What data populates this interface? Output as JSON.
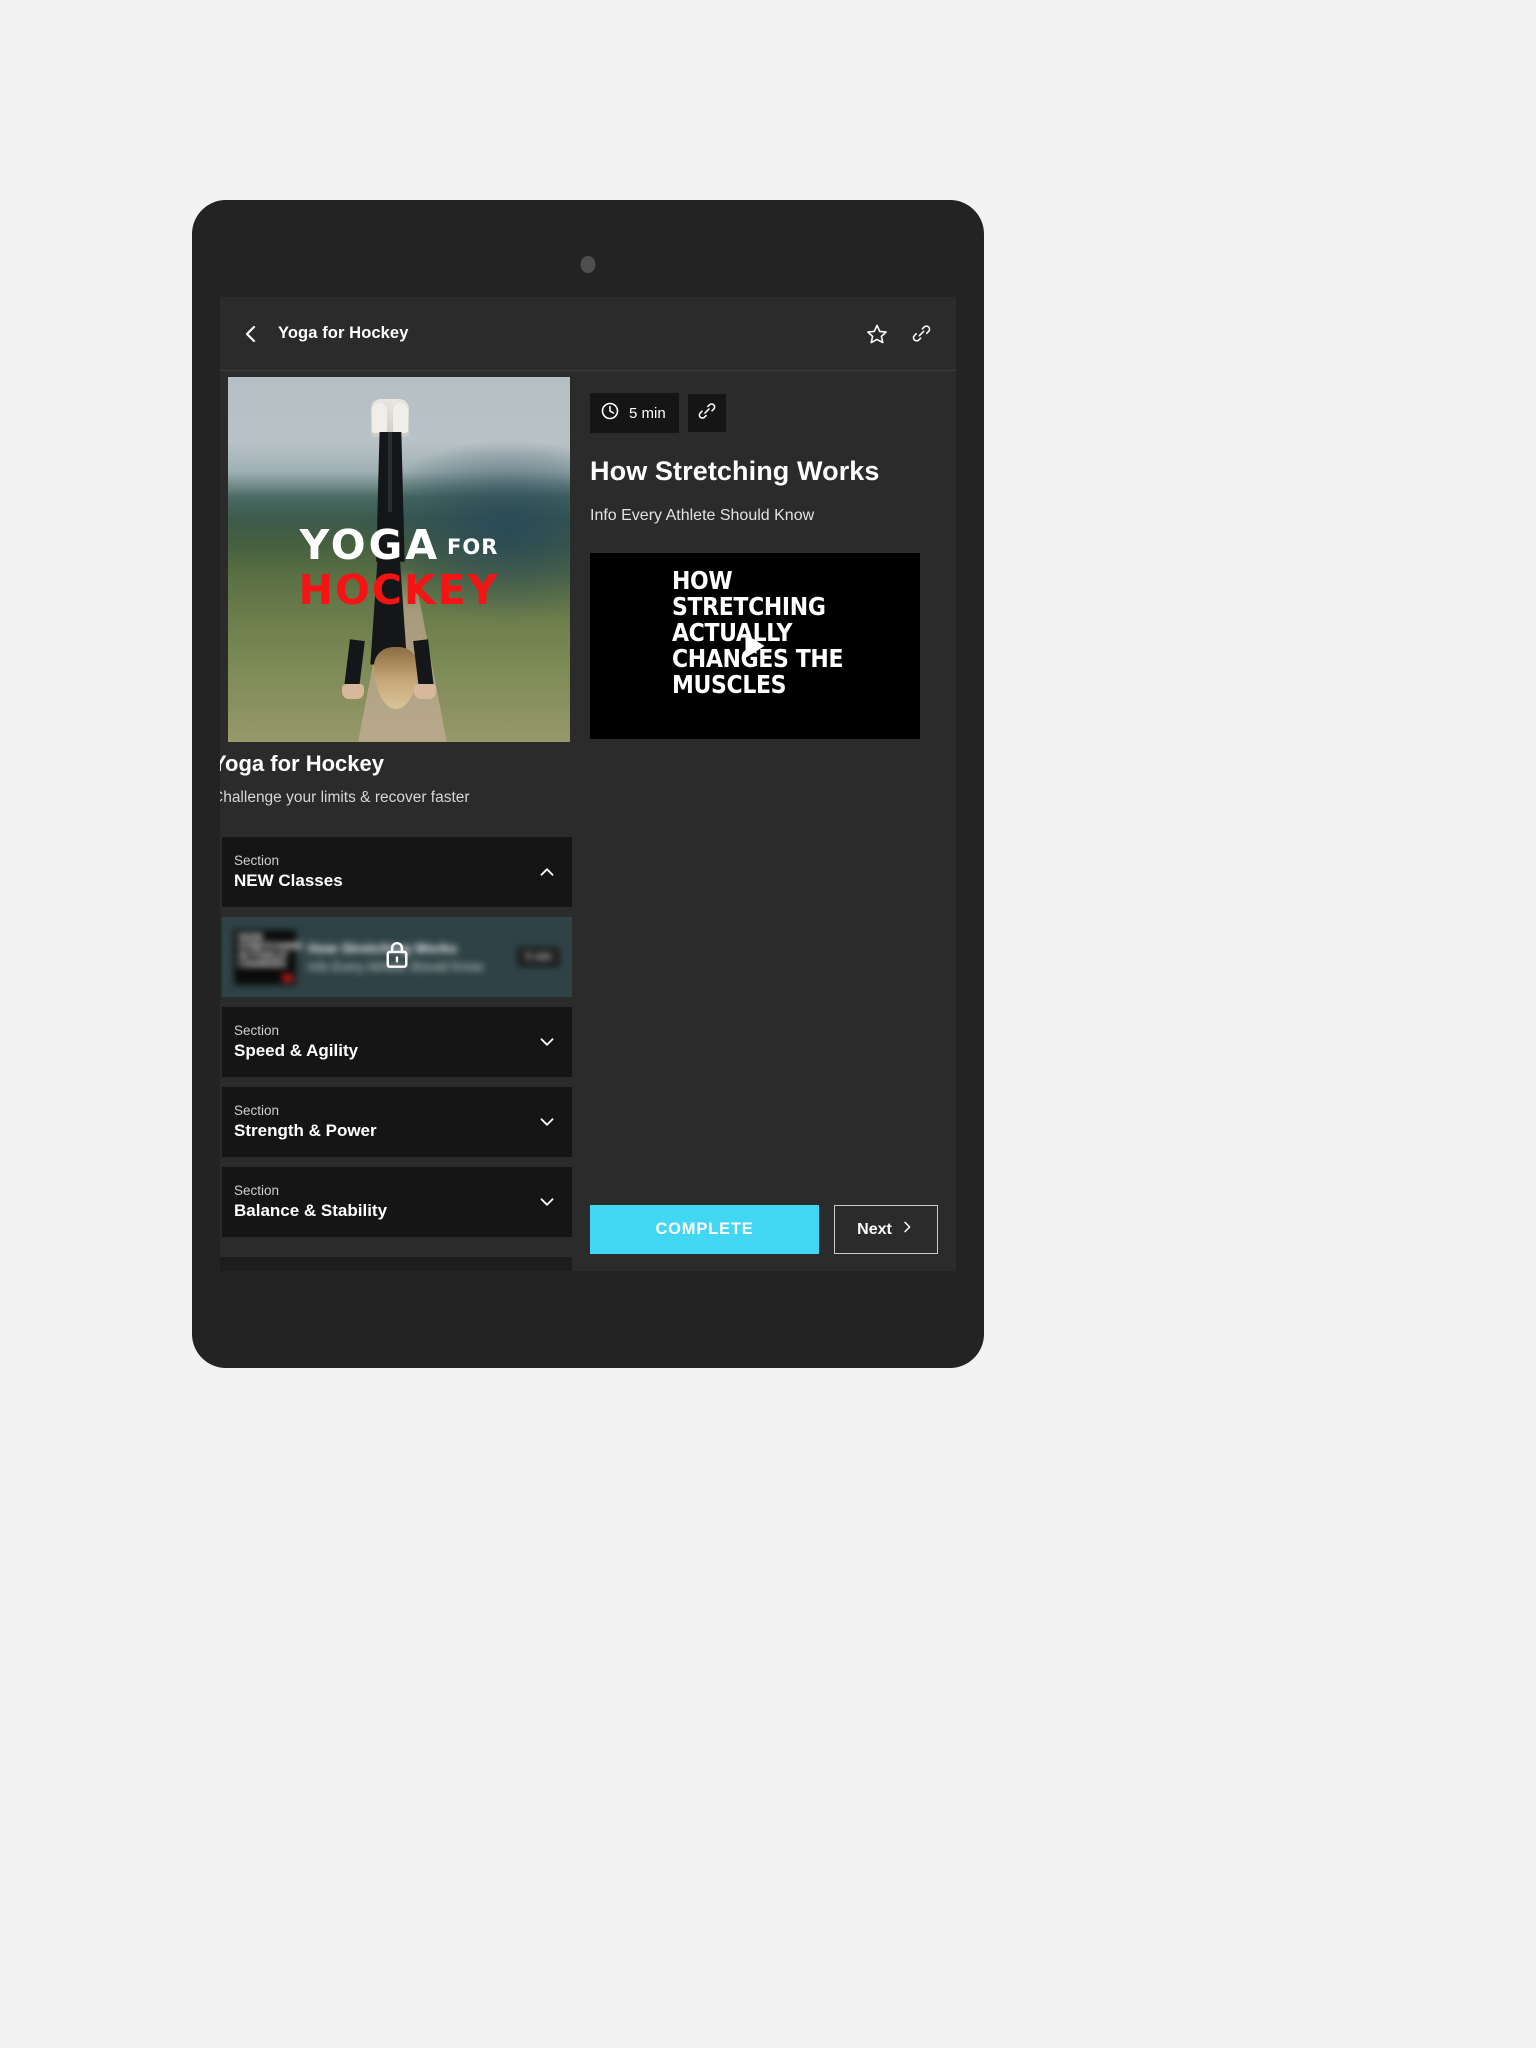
{
  "appbar": {
    "back_icon": "chevron-left-icon",
    "title": "Yoga for Hockey",
    "favorite_icon": "star-icon",
    "share_icon": "link-icon"
  },
  "course": {
    "hero_title_line1": "YOGA",
    "hero_title_for": "FOR",
    "hero_title_line2": "HOCKEY",
    "title": "Yoga for Hockey",
    "subtitle": "Challenge your limits & recover faster"
  },
  "sections": [
    {
      "kicker": "Section",
      "name": "NEW Classes",
      "chevron": "chevron-up-icon",
      "expanded": true
    },
    {
      "kicker": "Section",
      "name": "Speed & Agility",
      "chevron": "chevron-down-icon",
      "expanded": false
    },
    {
      "kicker": "Section",
      "name": "Strength & Power",
      "chevron": "chevron-down-icon",
      "expanded": false
    },
    {
      "kicker": "Section",
      "name": "Balance & Stability",
      "chevron": "chevron-down-icon",
      "expanded": false
    }
  ],
  "locked_lesson": {
    "thumb_text": "HOW\nSTRETCHING\nACTUALLY\nCHANGES",
    "name": "How Stretching Works",
    "description": "Info Every Athlete Should Know",
    "duration": "5 min",
    "lock_icon": "lock-icon",
    "locked": true
  },
  "lesson": {
    "duration": "5 min",
    "clock_icon": "clock-icon",
    "link_icon": "link-icon",
    "title": "How Stretching Works",
    "subtitle": "Info Every Athlete Should Know",
    "video_text": "HOW\nSTRETCHING\nACTUALLY\nCHANGES THE\nMUSCLES",
    "play_icon": "play-icon"
  },
  "actions": {
    "complete_label": "COMPLETE",
    "next_label": "Next",
    "next_icon": "chevron-right-icon"
  },
  "colors": {
    "accent": "#41d6f2",
    "screen_bg": "#2b2b2b",
    "section_bg": "#151515",
    "locked_bg": "#2f4347",
    "hero_red": "#f51313"
  }
}
